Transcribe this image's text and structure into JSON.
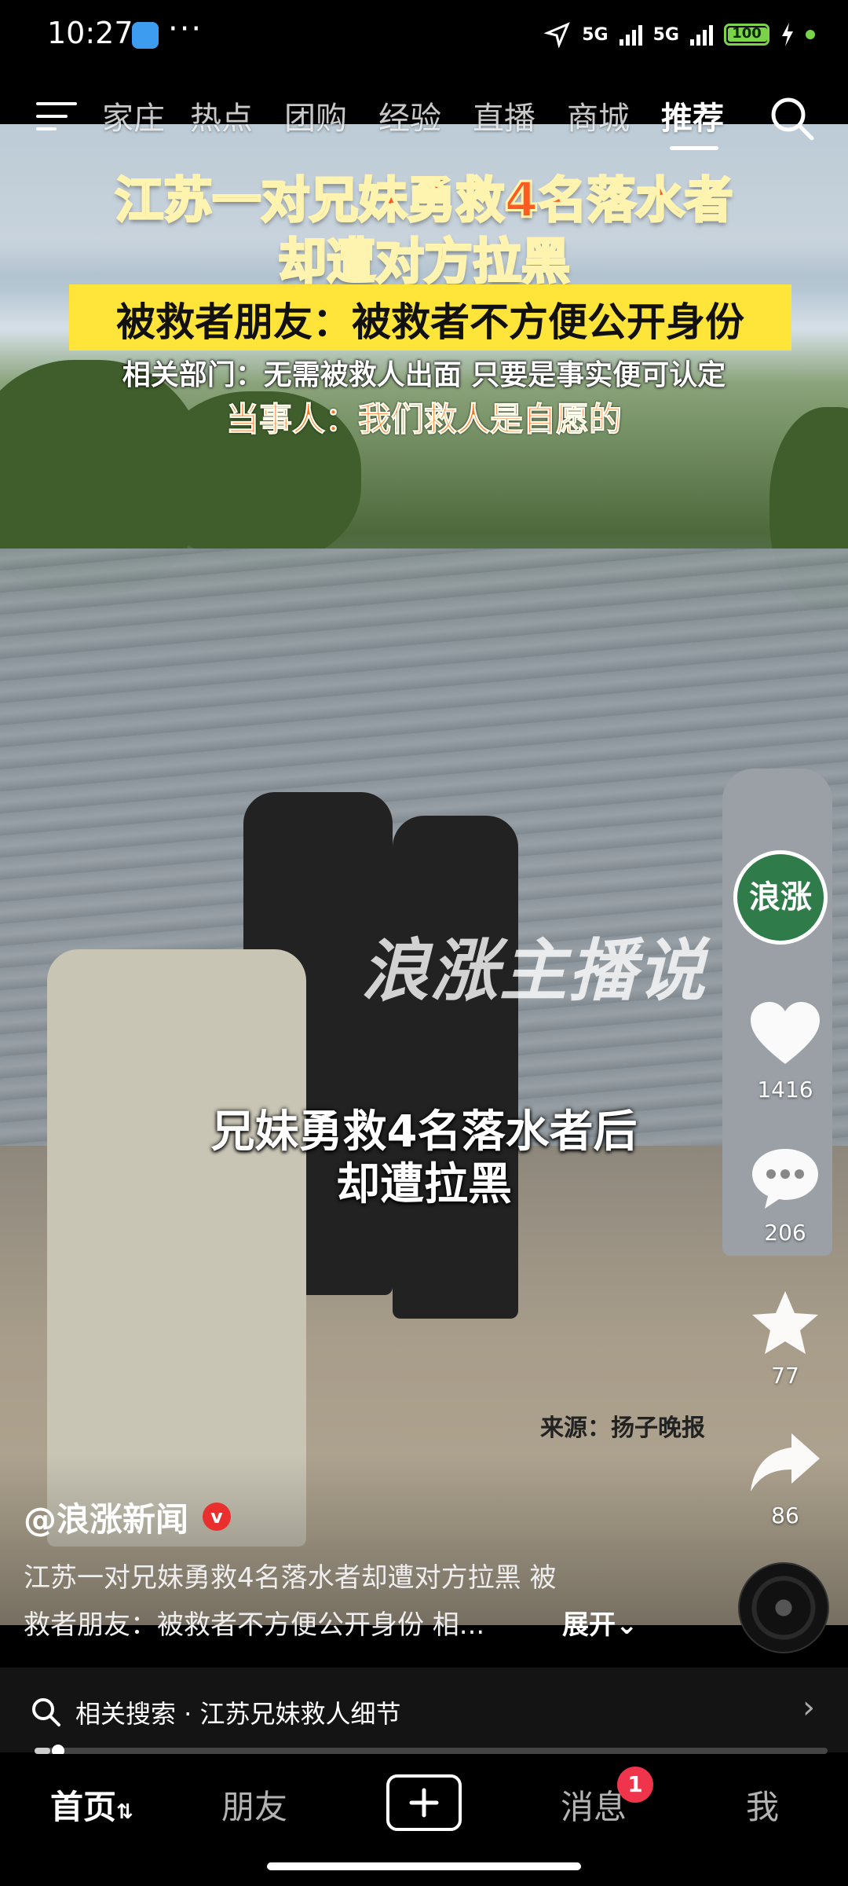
{
  "status_bar": {
    "time": "10:27",
    "more": "···",
    "signal_1": "5G",
    "signal_2": "5G",
    "battery": "100",
    "battery_level": 1.0
  },
  "top_nav": {
    "tabs": [
      "家庄",
      "热点",
      "团购",
      "经验",
      "直播",
      "商城",
      "推荐"
    ],
    "active_tab": "推荐"
  },
  "video": {
    "headline_1": "江苏一对兄妹勇救4名落水者",
    "headline_2": "却遭对方拉黑",
    "banner": "被救者朋友：被救者不方便公开身份",
    "dept_line": "相关部门：无需被救人出面 只要是事实便可认定",
    "party_line": "当事人：我们救人是自愿的",
    "watermark": "浪涨主播说",
    "subtitle_1": "兄妹勇救4名落水者后",
    "subtitle_2": "却遭拉黑",
    "source": "来源：扬子晚报"
  },
  "actions": {
    "avatar_text": "浪涨",
    "likes": "1416",
    "comments": "206",
    "favorites": "77",
    "shares": "86"
  },
  "caption": {
    "author": "@浪涨新闻",
    "verified": "v",
    "desc_line_1": "江苏一对兄妹勇救4名落水者却遭对方拉黑 被",
    "desc_line_2": "救者朋友：被救者不方便公开身份 相...",
    "expand": "展开⌄"
  },
  "related": {
    "text": "相关搜索 · 江苏兄妹救人细节",
    "chevron": "›",
    "progress": 0.02
  },
  "bottom_tabs": {
    "home": "首页",
    "home_suffix": "⇅",
    "friends": "朋友",
    "add": "+",
    "messages": "消息",
    "messages_badge": "1",
    "me": "我"
  },
  "colors": {
    "headline": "#ff5a1f",
    "banner": "#ffe43a",
    "badge": "#f0344b",
    "battery": "#7bd34a"
  }
}
